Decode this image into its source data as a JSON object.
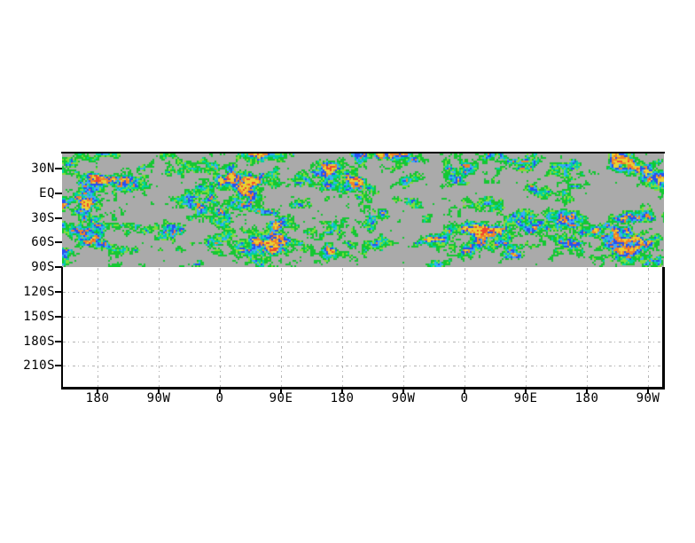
{
  "figure": {
    "page_background": "#ffffff",
    "frame_color": "#000000",
    "grid_color": "#b4b4b4",
    "text_color": "#000000"
  },
  "chart_data": {
    "type": "heatmap",
    "title": "",
    "xlabel": "",
    "ylabel": "",
    "x_tick_labels": [
      "180",
      "90W",
      "0",
      "90E",
      "180",
      "90W",
      "0",
      "90E",
      "180",
      "90W"
    ],
    "y_tick_labels": [
      "30N",
      "EQ",
      "30S",
      "60S",
      "90S",
      "120S",
      "150S",
      "180S",
      "210S"
    ],
    "legend": "none",
    "grid": "dash-dot light gray lines at every tick, visible only in the empty region below the 90S line",
    "field": {
      "description": "pixelated shaded scalar field (GrADS-style grfill) on a gray background band occupying the plot from the top frame line down to the 90S gridline; region below 90S is empty white",
      "background": "#aaaaaa",
      "band_rows": "30N through 90S",
      "structure": "noisy filament/blob field: widespread green, aqua/light-blue rims around blue patches, orange+yellow cores at extremes, large gray gaps; densest colorful band near 60S, mostly gray strip just above 90S",
      "palette": [
        {
          "name": "green",
          "hex": "#14c832"
        },
        {
          "name": "lime",
          "hex": "#82dc3c"
        },
        {
          "name": "aqua",
          "hex": "#00d2a0"
        },
        {
          "name": "lightblue",
          "hex": "#3caafa"
        },
        {
          "name": "blue",
          "hex": "#2850f0"
        },
        {
          "name": "orange",
          "hex": "#f08228"
        },
        {
          "name": "yellow",
          "hex": "#e6d232"
        },
        {
          "name": "red",
          "hex": "#f04632"
        }
      ]
    }
  }
}
